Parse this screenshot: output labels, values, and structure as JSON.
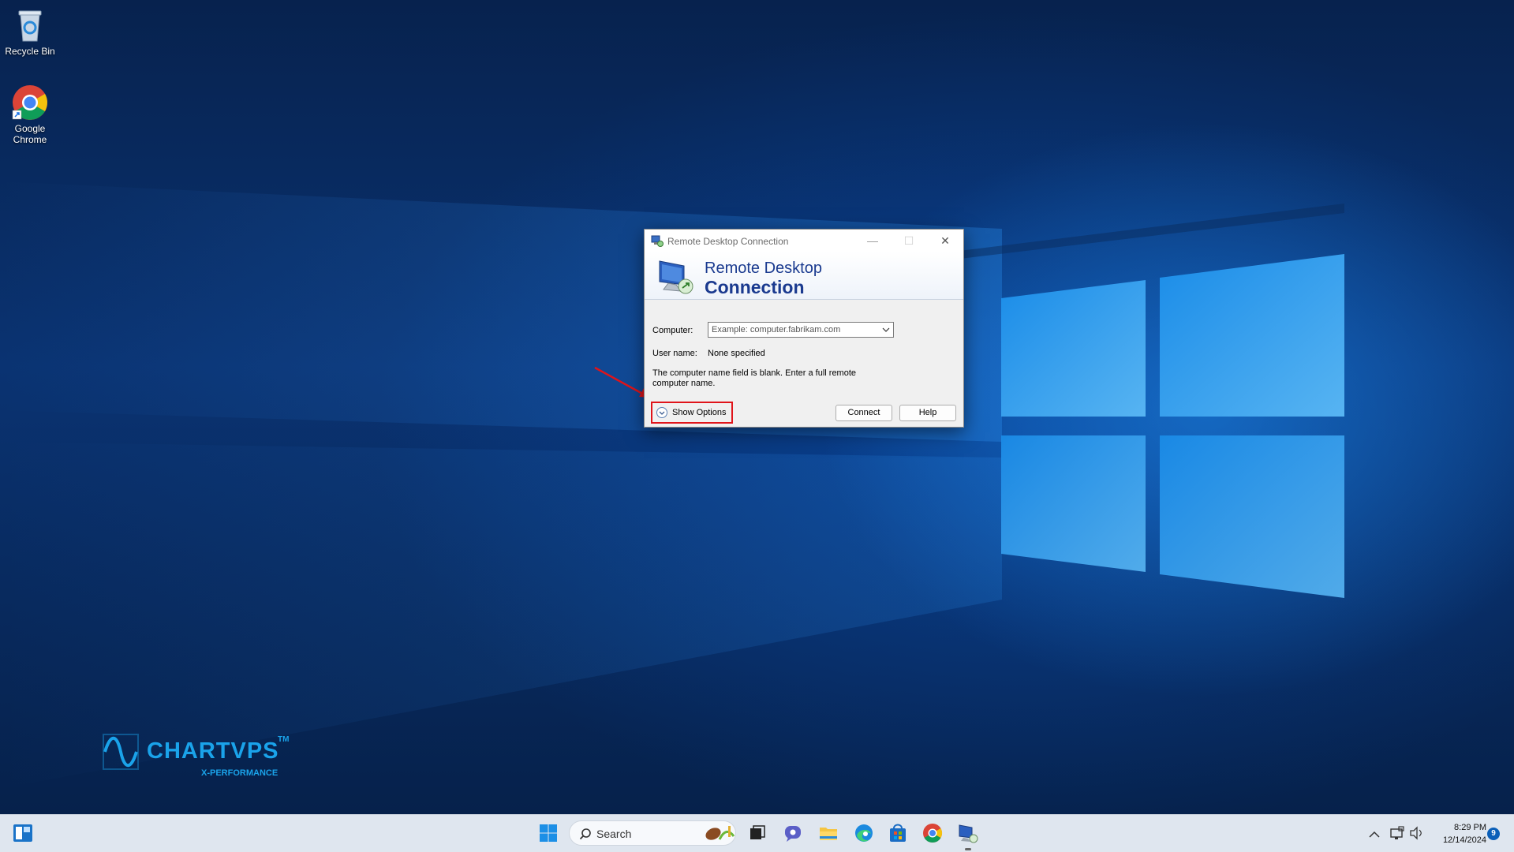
{
  "desktop": {
    "icons": [
      {
        "label": "Recycle Bin"
      },
      {
        "label": "Google Chrome"
      }
    ],
    "watermark": {
      "name": "CHARTVPS",
      "tm": "TM",
      "tagline": "X-PERFORMANCE"
    }
  },
  "dialog": {
    "title": "Remote Desktop Connection",
    "header_line1": "Remote Desktop",
    "header_line2": "Connection",
    "computer_label": "Computer:",
    "computer_placeholder": "Example: computer.fabrikam.com",
    "username_label": "User name:",
    "username_value": "None specified",
    "message": "The computer name field is blank. Enter a full remote computer name.",
    "show_options_label": "Show Options",
    "connect_label": "Connect",
    "help_label": "Help",
    "minimize_glyph": "—",
    "maximize_glyph": "☐",
    "close_glyph": "✕"
  },
  "taskbar": {
    "search_label": "Search",
    "time": "8:29 PM",
    "date": "12/14/2024",
    "notification_count": "9"
  },
  "colors": {
    "highlight_box": "#e0141a",
    "annotation_arrow": "#e0141a",
    "header_text": "#1a3a8f",
    "brand": "#1aa3ea"
  }
}
